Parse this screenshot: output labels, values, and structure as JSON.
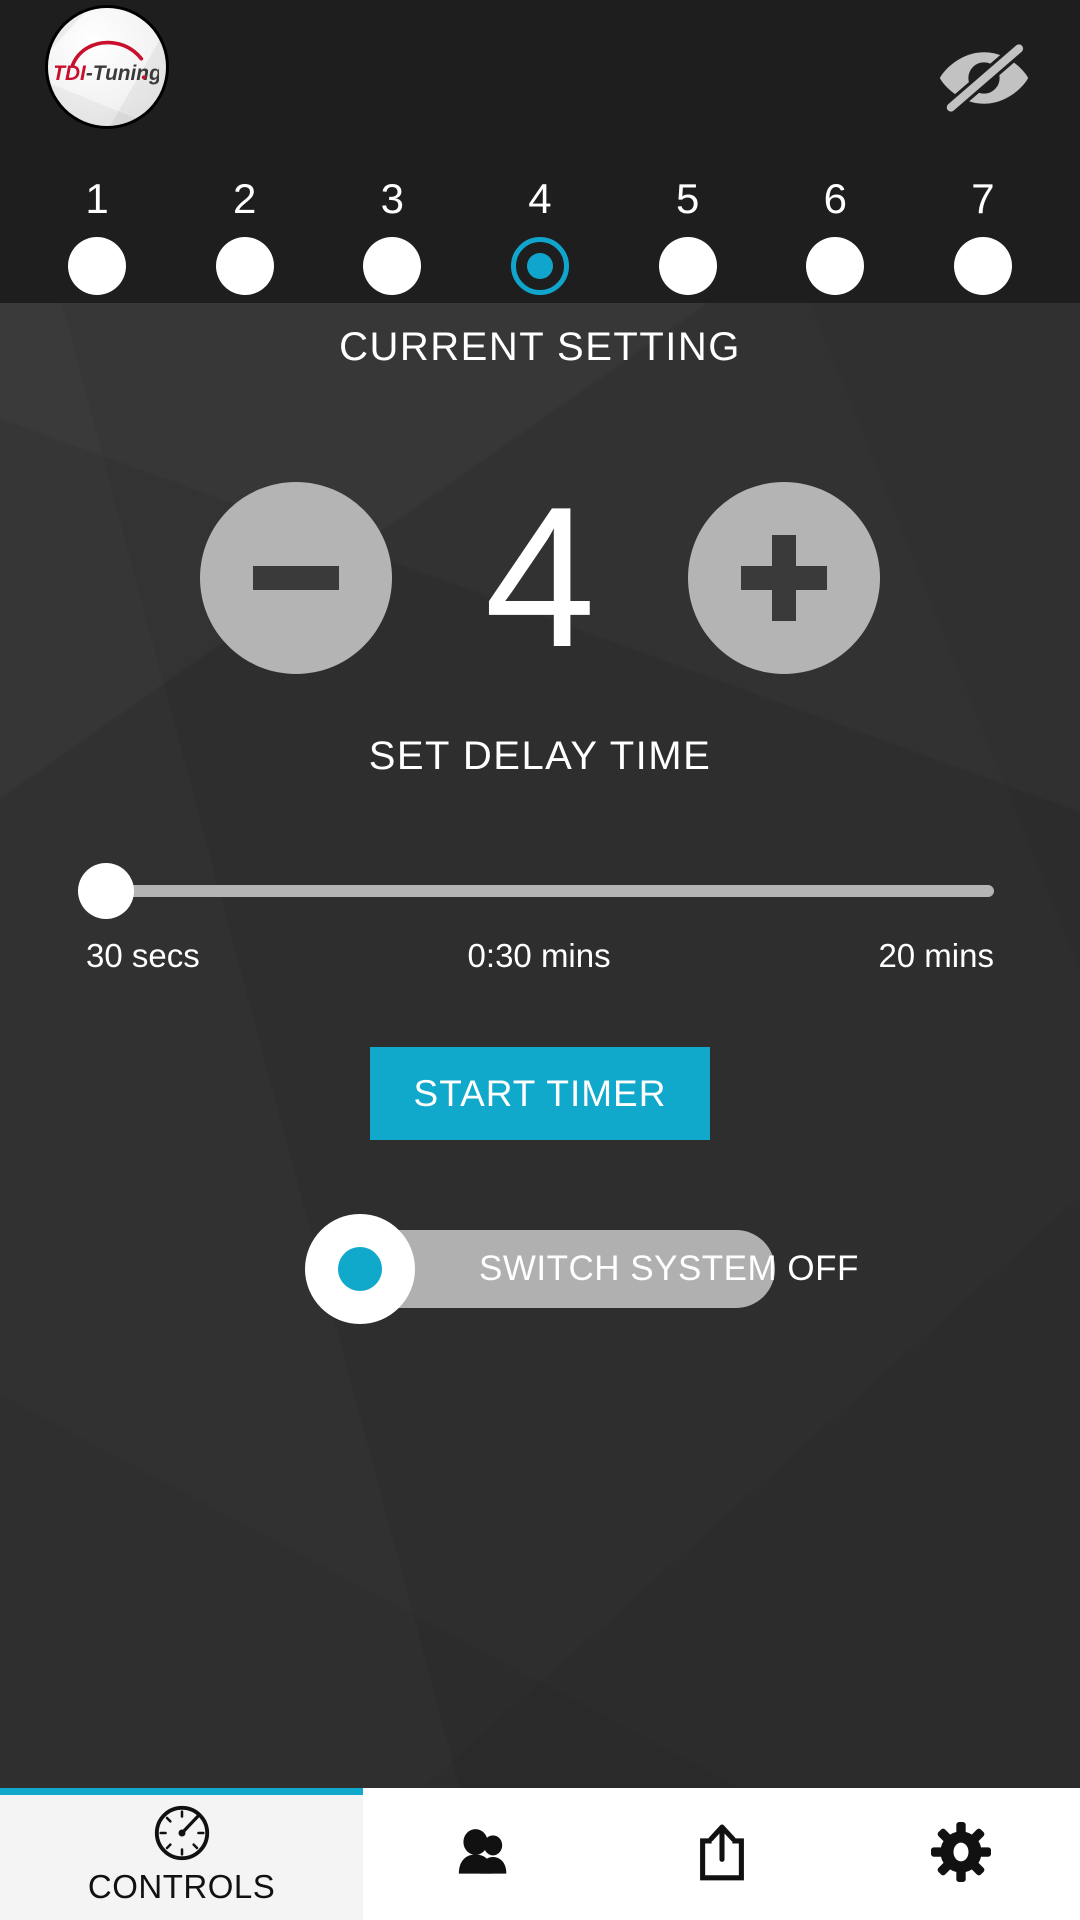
{
  "header": {
    "logo_text_primary": "TDI",
    "logo_text_secondary": "-Tuning",
    "logo_name": "tdi-tuning-logo",
    "visibility_icon": "eye-slash-icon",
    "brand_red": "#c8102e",
    "brand_dark": "#3a3a3a"
  },
  "selector": {
    "numbers": [
      "1",
      "2",
      "3",
      "4",
      "5",
      "6",
      "7"
    ],
    "selected_index": 3,
    "accent": "#10a5cd"
  },
  "main": {
    "current_setting_label": "CURRENT SETTING",
    "current_setting_value": "4",
    "decrease_label": "−",
    "increase_label": "+",
    "set_delay_label": "SET DELAY TIME",
    "slider": {
      "min_label": "30 secs",
      "value_label": "0:30 mins",
      "max_label": "20 mins",
      "percent": 0
    },
    "start_timer_label": "START TIMER",
    "switch_label": "SWITCH SYSTEM OFF",
    "accent": "#10a8cb"
  },
  "tabbar": {
    "tabs": [
      {
        "label": "CONTROLS",
        "icon": "gauge-icon",
        "active": true
      },
      {
        "label": "",
        "icon": "users-icon",
        "active": false
      },
      {
        "label": "",
        "icon": "share-icon",
        "active": false
      },
      {
        "label": "",
        "icon": "gear-icon",
        "active": false
      }
    ],
    "indicator_color": "#10a8cb"
  }
}
